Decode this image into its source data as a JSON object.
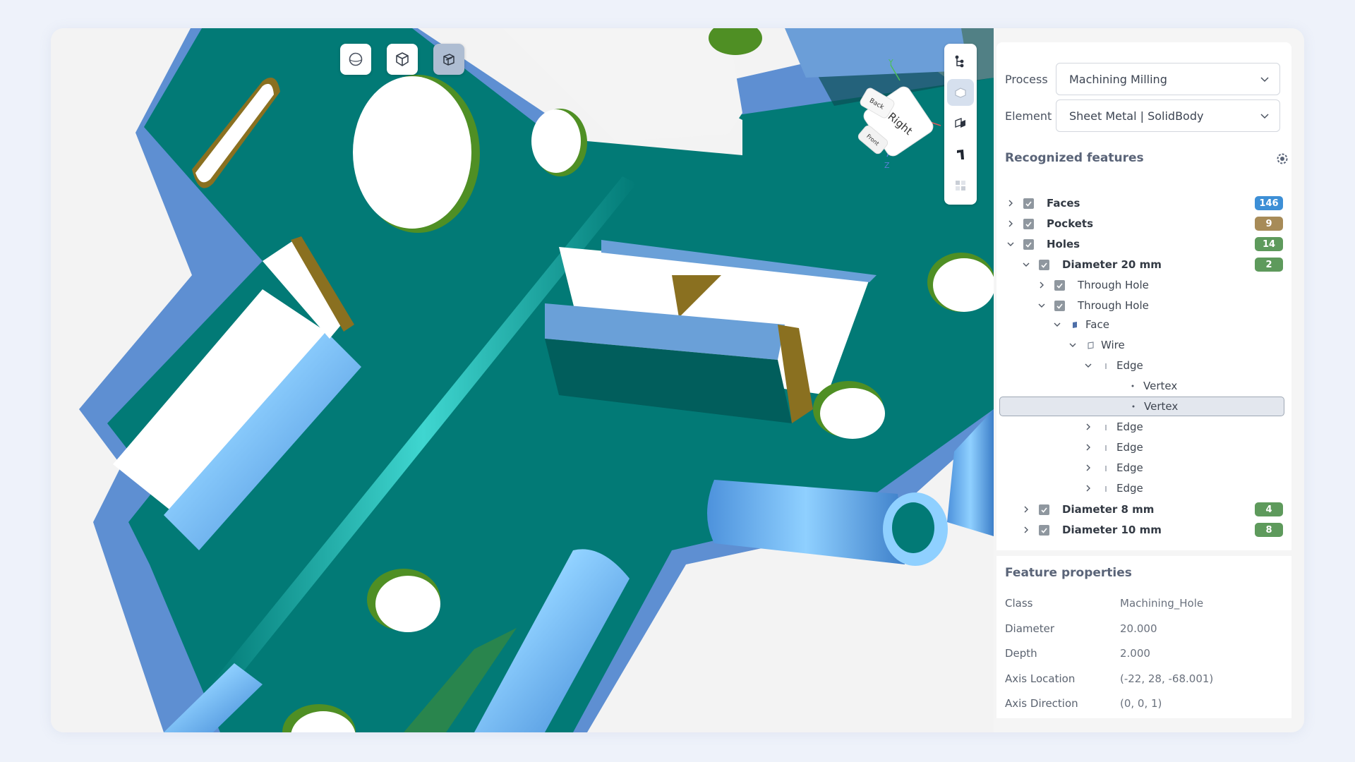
{
  "toolbar": {
    "buttons": [
      "sphere-view-icon",
      "cube-view-icon",
      "wireframe-view-icon"
    ],
    "active": "wireframe-view-icon"
  },
  "side_toolbar": {
    "buttons": [
      "feature-tree-icon",
      "shaded-shape-icon",
      "shapes-icon",
      "sheet-metal-icon",
      "grid-icon"
    ],
    "active": "shaded-shape-icon"
  },
  "view_cube": {
    "front": "Right",
    "top": "Back",
    "left": "Front",
    "axis_y": "Y",
    "axis_z": "Z"
  },
  "panel": {
    "process_label": "Process",
    "process_value": "Machining Milling",
    "element_label": "Element",
    "element_value": "Sheet Metal | SolidBody",
    "features_title": "Recognized features",
    "tree": [
      {
        "label": "Faces",
        "expanded": false,
        "checked": true,
        "bold": true,
        "badge": "146",
        "badge_color": "#3d8fd6"
      },
      {
        "label": "Pockets",
        "expanded": false,
        "checked": true,
        "bold": true,
        "badge": "9",
        "badge_color": "#a78b58"
      },
      {
        "label": "Holes",
        "expanded": true,
        "checked": true,
        "bold": true,
        "badge": "14",
        "badge_color": "#5e9a5c"
      },
      {
        "label": "Diameter 20 mm",
        "expanded": true,
        "checked": true,
        "bold": true,
        "badge": "2",
        "badge_color": "#5e9a5c"
      },
      {
        "label": "Through Hole",
        "expanded": false,
        "checked": true
      },
      {
        "label": "Through Hole",
        "expanded": true,
        "checked": true
      },
      {
        "label": "Face",
        "expanded": true,
        "icon": "face-icon"
      },
      {
        "label": "Wire",
        "expanded": true,
        "icon": "wire-icon"
      },
      {
        "label": "Edge",
        "expanded": true,
        "icon": "edge-icon"
      },
      {
        "label": "Vertex",
        "icon": "vertex-icon"
      },
      {
        "label": "Vertex",
        "icon": "vertex-icon",
        "selected": true
      },
      {
        "label": "Edge",
        "expanded": false,
        "icon": "edge-icon"
      },
      {
        "label": "Edge",
        "expanded": false,
        "icon": "edge-icon"
      },
      {
        "label": "Edge",
        "expanded": false,
        "icon": "edge-icon"
      },
      {
        "label": "Edge",
        "expanded": false,
        "icon": "edge-icon"
      },
      {
        "label": "Diameter 8 mm",
        "expanded": false,
        "checked": true,
        "bold": true,
        "badge": "4",
        "badge_color": "#5e9a5c"
      },
      {
        "label": "Diameter 10 mm",
        "expanded": false,
        "checked": true,
        "bold": true,
        "badge": "8",
        "badge_color": "#5e9a5c"
      }
    ],
    "properties_title": "Feature properties",
    "properties": [
      {
        "key": "Class",
        "value": "Machining_Hole"
      },
      {
        "key": "Diameter",
        "value": "20.000"
      },
      {
        "key": "Depth",
        "value": "2.000"
      },
      {
        "key": "Axis Location",
        "value": "(-22, 28, -68.001)"
      },
      {
        "key": "Axis Direction",
        "value": "(0, 0, 1)"
      }
    ]
  },
  "colors": {
    "part_face": "#027a76",
    "part_dark": "#015c5a",
    "bend": "#66b6f2",
    "hole_wall": "#4f9a24",
    "pocket_wall": "#8f7a1a"
  }
}
